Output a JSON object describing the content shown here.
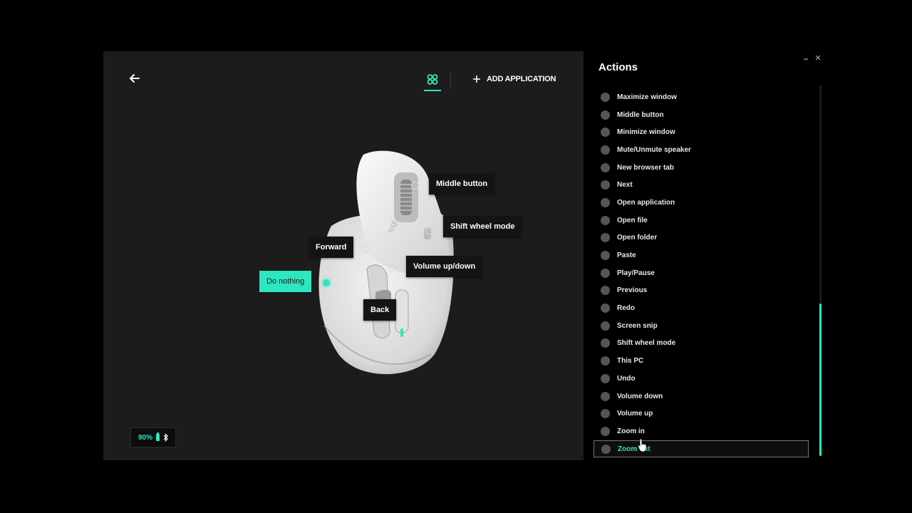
{
  "header": {
    "add_application_label": "ADD APPLICATION"
  },
  "mouse_buttons": {
    "middle": "Middle button",
    "shift_wheel": "Shift wheel mode",
    "forward": "Forward",
    "volume": "Volume up/down",
    "gesture": "Do nothing",
    "back": "Back"
  },
  "battery": {
    "level": "90%"
  },
  "actions": {
    "title": "Actions",
    "items": [
      "Maximize window",
      "Middle button",
      "Minimize window",
      "Mute/Unmute speaker",
      "New browser tab",
      "Next",
      "Open application",
      "Open file",
      "Open folder",
      "Paste",
      "Play/Pause",
      "Previous",
      "Redo",
      "Screen snip",
      "Shift wheel mode",
      "This PC",
      "Undo",
      "Volume down",
      "Volume up",
      "Zoom in",
      "Zoom out"
    ],
    "selected_index": 20
  },
  "colors": {
    "accent": "#2ee6c0",
    "panel_bg": "#1c1c1c",
    "sidebar_bg": "#000000"
  }
}
